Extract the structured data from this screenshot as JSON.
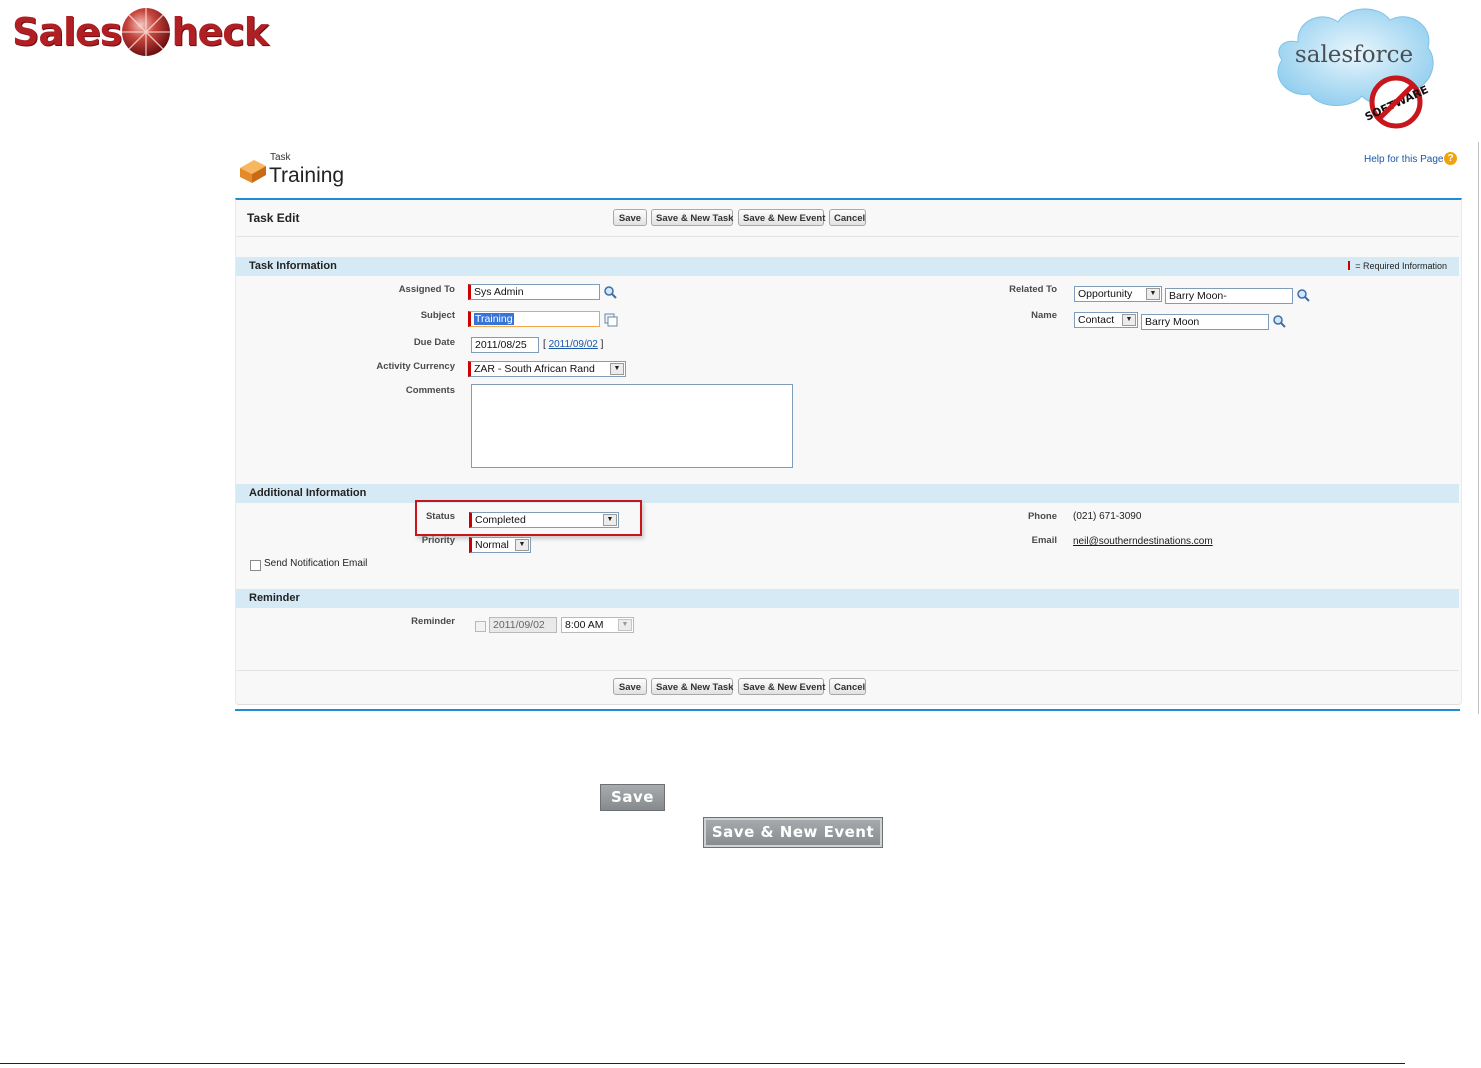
{
  "branding": {
    "saleschek_left": "Sales",
    "saleschek_right": "heck",
    "salesforce_word": "salesforce",
    "software_stamp": "SOFTWARE"
  },
  "page": {
    "kicker": "Task",
    "title": "Training",
    "help_link": "Help for this Page",
    "help_icon": "?"
  },
  "toolbar": {
    "title": "Task Edit",
    "buttons": [
      "Save",
      "Save & New Task",
      "Save & New Event",
      "Cancel"
    ]
  },
  "sections": {
    "task_info": "Task Information",
    "required_legend": "= Required Information",
    "additional": "Additional Information",
    "reminder": "Reminder"
  },
  "fields": {
    "assigned_to": {
      "label": "Assigned To",
      "value": "Sys Admin"
    },
    "subject": {
      "label": "Subject",
      "value": "Training"
    },
    "due_date": {
      "label": "Due Date",
      "value": "2011/08/25",
      "today_link": "2011/09/02"
    },
    "currency": {
      "label": "Activity Currency",
      "value": "ZAR - South African Rand"
    },
    "comments": {
      "label": "Comments",
      "value": ""
    },
    "related_to": {
      "label": "Related To",
      "type": "Opportunity",
      "value": "Barry Moon-"
    },
    "name": {
      "label": "Name",
      "type": "Contact",
      "value": "Barry Moon"
    },
    "status": {
      "label": "Status",
      "value": "Completed"
    },
    "priority": {
      "label": "Priority",
      "value": "Normal"
    },
    "notify": {
      "label": "Send Notification Email",
      "checked": false
    },
    "phone": {
      "label": "Phone",
      "value": "(021) 671-3090"
    },
    "email": {
      "label": "Email",
      "value": "neil@southerndestinations.com"
    },
    "reminder": {
      "label": "Reminder",
      "date": "2011/09/02",
      "time": "8:00 AM",
      "checked": false
    }
  },
  "callout_buttons": {
    "save": "Save",
    "save_new_event": "Save & New Event"
  },
  "colors": {
    "brand_red": "#b01f24",
    "section_blue": "#d6eaf5",
    "accent_blue": "#1f8dd6",
    "required_red": "#cc0000"
  }
}
